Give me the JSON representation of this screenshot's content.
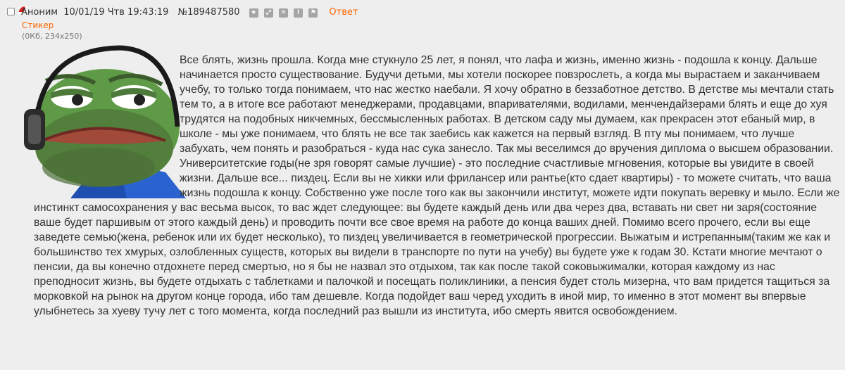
{
  "post": {
    "name": "Аноним",
    "datetime": "10/01/19 Чтв 19:43:19",
    "number": "№189487580",
    "icons": [
      "star-icon",
      "expand-icon",
      "close-icon",
      "warning-icon",
      "flag-icon"
    ],
    "reply_label": "Ответ",
    "file_label": "Стикер",
    "file_meta": "(0Кб, 234x250)",
    "message": "Все блять, жизнь прошла. Когда мне стукнуло 25 лет, я понял, что лафа и жизнь, именно жизнь - подошла к концу. Дальше начинается просто существование. Будучи детьми, мы хотели поскорее повзрослеть, а когда мы вырастаем и заканчиваем учебу, то только тогда понимаем, что нас жестко наебали. Я хочу обратно в беззаботное детство. В детстве мы мечтали стать тем то, а в итоге все работают менеджерами, продавцами, впаривателями, водилами, менчендайзерами блять и еще до хуя трудятся на подобных никчемных, бессмысленных работах. В детском саду мы думаем, как прекрасен этот ебаный мир, в школе - мы уже понимаем, что блять не все так заебись как кажется на первый взгляд. В пту мы понимаем, что лучше забухать, чем понять и разобраться - куда нас сука занесло. Так мы веселимся до вручения диплома о высшем образовании. Университетские годы(не зря говорят самые лучшие) - это последние счастливые мгновения, которые вы увидите в своей жизни. Дальше все... пиздец. Если вы не хикки или фрилансер или рантье(кто сдает квартиры) - то можете считать, что ваша жизнь подошла к концу. Собственно уже после того как вы закончили институт, можете идти покупать веревку и мыло. Если же инстинкт самосохранения у вас весьма высок, то вас ждет следующее: вы будете каждый день или два через два, вставать ни свет ни заря(состояние ваше будет паршивым от этого каждый день) и проводить почти все свое время на работе до конца ваших дней. Помимо всего прочего, если вы еще заведете семью(жена, ребенок или их будет несколько), то пиздец увеличивается в геометрической прогрессии. Выжатым и истрепанным(таким же как и большинство тех хмурых, озлобленных существ, которых вы видели в транспорте по пути на учебу) вы будете уже к годам 30. Кстати многие мечтают о пенсии, да вы конечно отдохнете перед смертью, но я бы не назвал это отдыхом, так как после такой соковыжималки, которая каждому из нас преподносит жизнь, вы будете отдыхать с таблетками и палочкой и посещать поликлиники, а пенсия будет столь мизерна, что вам придется тащиться за морковкой на рынок на другом конце города, ибо там дешевле. Когда подойдет ваш черед уходить в иной мир, то именно в этот момент вы впервые улыбнетесь за хуеву тучу лет с того момента, когда последний раз вышли из института, ибо смерть явится освобождением."
  },
  "colors": {
    "background": "#eeeeee",
    "accent": "#ff6600",
    "text": "#333333",
    "meta": "#777777"
  }
}
